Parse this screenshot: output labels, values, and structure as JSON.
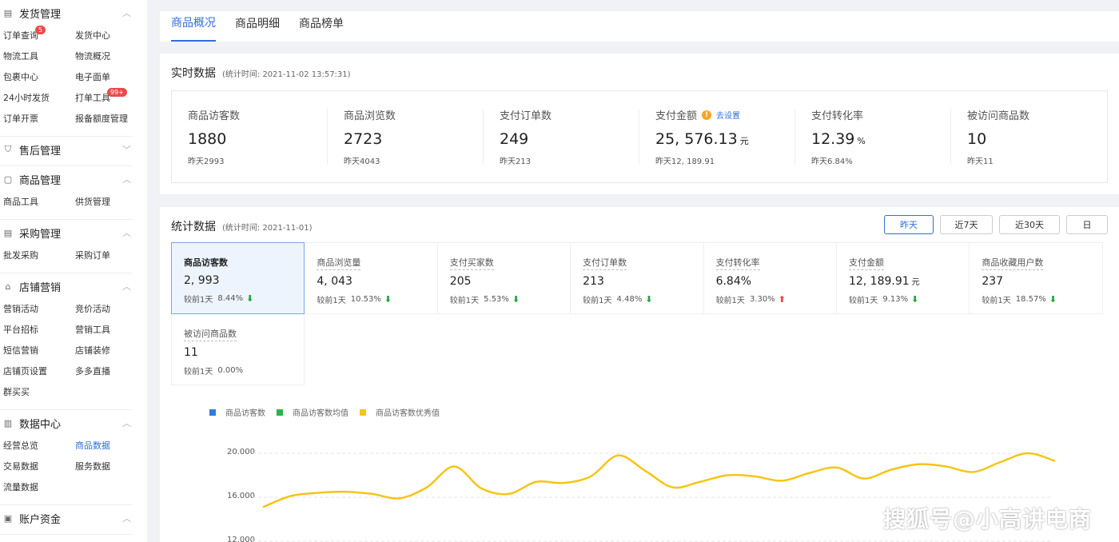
{
  "sidebar": {
    "sections": [
      {
        "title": "发货管理",
        "icon": "doc-icon",
        "chev": "︿",
        "items": [
          "订单查询",
          "发货中心",
          "物流工具",
          "物流概况",
          "包裹中心",
          "电子面单",
          "24小时发货",
          "打单工具",
          "订单开票",
          "报备额度管理"
        ]
      },
      {
        "title": "售后管理",
        "icon": "shield-icon",
        "chev": "﹀",
        "items": []
      },
      {
        "title": "商品管理",
        "icon": "bag-icon",
        "chev": "︿",
        "items": [
          "商品工具",
          "供货管理"
        ]
      },
      {
        "title": "采购管理",
        "icon": "purchase-icon",
        "chev": "︿",
        "items": [
          "批发采购",
          "采购订单"
        ]
      },
      {
        "title": "店铺营销",
        "icon": "store-icon",
        "chev": "︿",
        "items": [
          "营销活动",
          "竞价活动",
          "平台招标",
          "营销工具",
          "短信营销",
          "店铺装修",
          "店铺页设置",
          "多多直播",
          "群买买"
        ]
      },
      {
        "title": "数据中心",
        "icon": "chart-icon",
        "chev": "︿",
        "items": [
          "经营总览",
          "商品数据",
          "交易数据",
          "服务数据",
          "流量数据"
        ]
      },
      {
        "title": "账户资金",
        "icon": "wallet-icon",
        "chev": "︿",
        "items": []
      }
    ],
    "badges": {
      "order_query": "5",
      "print_tool": "99+"
    },
    "active_item": "商品数据"
  },
  "tabs": [
    "商品概况",
    "商品明细",
    "商品榜单"
  ],
  "realtime": {
    "title": "实时数据",
    "subtitle": "(统计时间: 2021-11-02 13:57:31)",
    "metrics": [
      {
        "label": "商品访客数",
        "value": "1880",
        "unit": "",
        "yesterday": "昨天2993"
      },
      {
        "label": "商品浏览数",
        "value": "2723",
        "unit": "",
        "yesterday": "昨天4043"
      },
      {
        "label": "支付订单数",
        "value": "249",
        "unit": "",
        "yesterday": "昨天213"
      },
      {
        "label": "支付金额",
        "value": "25, 576.13",
        "unit": "元",
        "yesterday": "昨天12, 189.91",
        "warn": "!",
        "link": "去设置"
      },
      {
        "label": "支付转化率",
        "value": "12.39",
        "unit": "%",
        "yesterday": "昨天6.84%"
      },
      {
        "label": "被访问商品数",
        "value": "10",
        "unit": "",
        "yesterday": "昨天11"
      }
    ]
  },
  "stats": {
    "title": "统计数据",
    "subtitle": "(统计时间: 2021-11-01)",
    "ranges": [
      "昨天",
      "近7天",
      "近30天",
      "日"
    ],
    "active_range": "昨天",
    "cells": [
      {
        "label": "商品访客数",
        "value": "2, 993",
        "unit": "",
        "cmp": "较前1天",
        "pct": "8.44%",
        "dir": "down"
      },
      {
        "label": "商品浏览量",
        "value": "4, 043",
        "unit": "",
        "cmp": "较前1天",
        "pct": "10.53%",
        "dir": "down"
      },
      {
        "label": "支付买家数",
        "value": "205",
        "unit": "",
        "cmp": "较前1天",
        "pct": "5.53%",
        "dir": "down"
      },
      {
        "label": "支付订单数",
        "value": "213",
        "unit": "",
        "cmp": "较前1天",
        "pct": "4.48%",
        "dir": "down"
      },
      {
        "label": "支付转化率",
        "value": "6.84%",
        "unit": "",
        "cmp": "较前1天",
        "pct": "3.30%",
        "dir": "up"
      },
      {
        "label": "支付金额",
        "value": "12, 189.91",
        "unit": "元",
        "cmp": "较前1天",
        "pct": "9.13%",
        "dir": "down"
      },
      {
        "label": "商品收藏用户数",
        "value": "237",
        "unit": "",
        "cmp": "较前1天",
        "pct": "18.57%",
        "dir": "down"
      },
      {
        "label": "被访问商品数",
        "value": "11",
        "unit": "",
        "cmp": "较前1天",
        "pct": "0.00%",
        "dir": ""
      }
    ]
  },
  "chart_data": {
    "type": "line",
    "series": [
      {
        "name": "商品访客数",
        "color": "#2a7de1",
        "values": []
      },
      {
        "name": "商品访客数均值",
        "color": "#2cb34a",
        "values": []
      },
      {
        "name": "商品访客数优秀值",
        "color": "#f5c518",
        "values": [
          15100,
          16100,
          16400,
          16500,
          16300,
          15900,
          16900,
          18800,
          16800,
          16300,
          17400,
          17300,
          17900,
          19800,
          18400,
          16900,
          17400,
          18000,
          17900,
          17500,
          18200,
          18700,
          17700,
          18500,
          19000,
          18800,
          18300,
          19200,
          20000,
          19300
        ]
      }
    ],
    "y_ticks": [
      "20.000",
      "16.000",
      "12.000"
    ],
    "ylim": [
      12000,
      20000
    ]
  },
  "watermark": "搜狐号@小高讲电商"
}
